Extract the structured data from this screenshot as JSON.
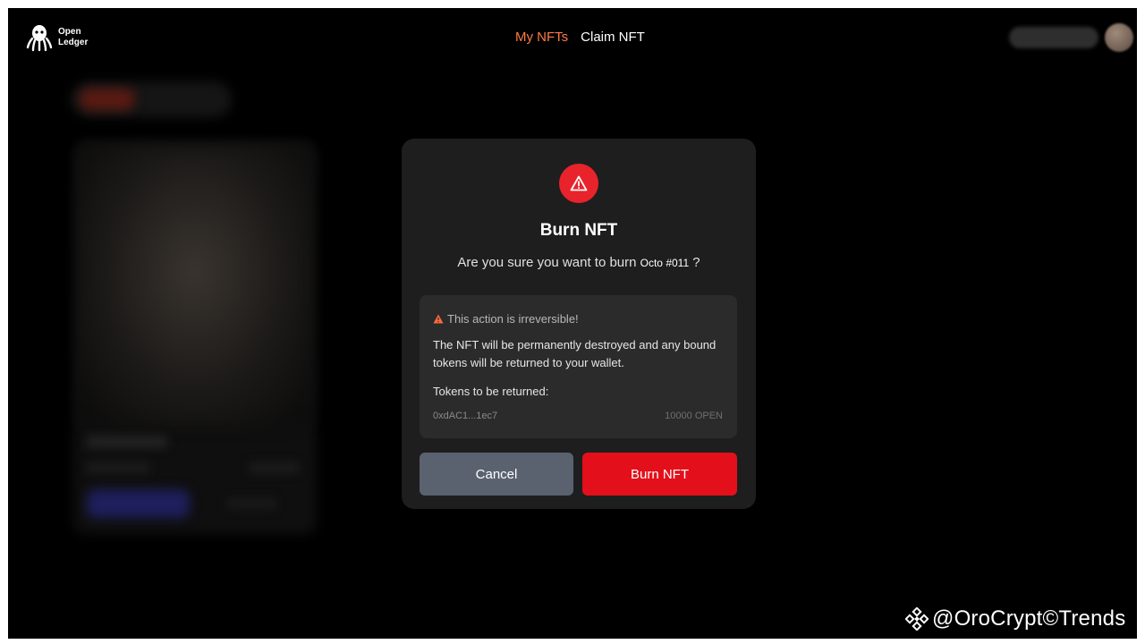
{
  "brand": {
    "name_line1": "Open",
    "name_line2": "Ledger",
    "logo_icon": "octopus-logo-icon"
  },
  "nav": {
    "items": [
      {
        "label": "My NFTs",
        "active": true
      },
      {
        "label": "Claim NFT",
        "active": false
      }
    ]
  },
  "modal": {
    "icon": "warning-icon",
    "title": "Burn NFT",
    "question_prefix": "Are you sure you want to burn ",
    "nft_name": "Octo #011",
    "question_suffix": " ?",
    "warning_title": "This action is irreversible!",
    "description": "The NFT will be permanently destroyed and any bound tokens will be returned to your wallet.",
    "tokens_label": "Tokens to be returned:",
    "token_address": "0xdAC1...1ec7",
    "token_amount": "10000 OPEN",
    "cancel_label": "Cancel",
    "burn_label": "Burn NFT"
  },
  "watermark": {
    "text": "@OroCrypt©Trends",
    "icon": "binance-diamond-icon"
  },
  "colors": {
    "accent": "#ff7a45",
    "danger": "#e3101b",
    "cancel": "#5a6270",
    "modal_bg": "#1e1e1e",
    "info_bg": "#2b2b2b",
    "page_bg": "#000000"
  }
}
